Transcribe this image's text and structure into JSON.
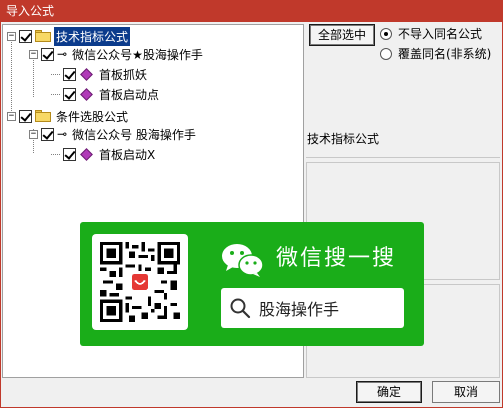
{
  "window": {
    "title": "导入公式"
  },
  "tree": {
    "nodes": [
      {
        "label": "技术指标公式",
        "selected": true
      },
      {
        "label": "微信公众号★股海操作手"
      },
      {
        "label": "首板抓妖"
      },
      {
        "label": "首板启动点"
      },
      {
        "label": "条件选股公式"
      },
      {
        "label": "微信公众号 股海操作手"
      },
      {
        "label": "首板启动X"
      }
    ]
  },
  "options": {
    "select_all_label": "全部选中",
    "radio_no_import_label": "不导入同名公式",
    "radio_overwrite_label": "覆盖同名(非系统)",
    "selected_radio": "no_import"
  },
  "detail": {
    "label": "技术指标公式"
  },
  "wechat_ad": {
    "title": "微信搜一搜",
    "search_text": "股海操作手",
    "color": "#1aad19"
  },
  "footer": {
    "ok_label": "确定",
    "cancel_label": "取消"
  },
  "colors": {
    "titlebar": "#c0392b",
    "selection": "#0b3b8c"
  }
}
